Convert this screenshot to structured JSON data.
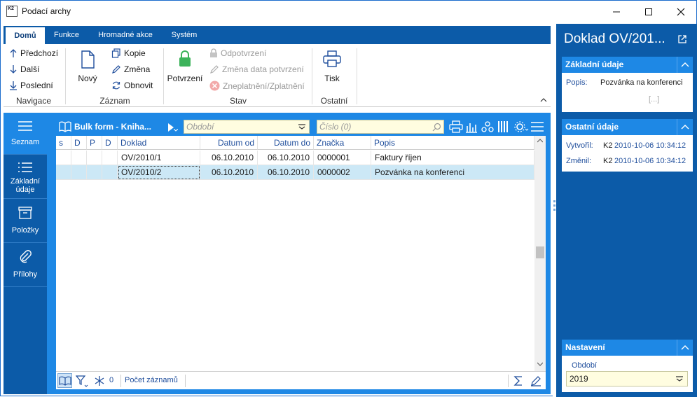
{
  "window": {
    "title": "Podací archy",
    "icon_text": "K2"
  },
  "ribbon": {
    "tabs": [
      "Domů",
      "Funkce",
      "Hromadné akce",
      "Systém"
    ],
    "navigace": {
      "label": "Navigace",
      "items": [
        "Předchozí",
        "Další",
        "Poslední"
      ]
    },
    "zaznam": {
      "label": "Záznam",
      "new": "Nový",
      "items": [
        "Kopie",
        "Změna",
        "Obnovit"
      ]
    },
    "stav": {
      "label": "Stav",
      "confirm": "Potvrzení",
      "items": [
        "Odpotvrzení",
        "Změna data potvrzení",
        "Zneplatnění/Zplatnění"
      ]
    },
    "ostatni": {
      "label": "Ostatní",
      "print": "Tisk"
    }
  },
  "leftnav": [
    {
      "label": "Seznam",
      "icon": "menu-icon"
    },
    {
      "label": "Základní\núdaje",
      "icon": "list-icon"
    },
    {
      "label": "Položky",
      "icon": "box-icon"
    },
    {
      "label": "Přílohy",
      "icon": "paperclip-icon"
    }
  ],
  "grid": {
    "bookmark": "Bulk form - Kniha...",
    "period_placeholder": "Období",
    "number_placeholder": "Číslo (0)",
    "columns": [
      "s",
      "D",
      "P",
      "D",
      "Doklad",
      "Datum od",
      "Datum do",
      "Značka",
      "Popis"
    ],
    "rows": [
      {
        "doklad": "OV/2010/1",
        "datum_od": "06.10.2010",
        "datum_do": "06.10.2010",
        "znacka": "0000001",
        "popis": "Faktury říjen"
      },
      {
        "doklad": "OV/2010/2",
        "datum_od": "06.10.2010",
        "datum_do": "06.10.2010",
        "znacka": "0000002",
        "popis": "Pozvánka na konferenci"
      }
    ],
    "status": {
      "count": "0",
      "records_label": "Počet záznamů"
    }
  },
  "right": {
    "title": "Doklad OV/201...",
    "zakladni": {
      "header": "Základní údaje",
      "popis_key": "Popis:",
      "popis_val": "Pozvánka na konferenci",
      "more": "[...]"
    },
    "ostatni": {
      "header": "Ostatní údaje",
      "created_key": "Vytvořil:",
      "created_user": "K2",
      "created_date": "2010-10-06 10:34:12",
      "changed_key": "Změnil:",
      "changed_user": "K2",
      "changed_date": "2010-10-06 10:34:12"
    },
    "nastaveni": {
      "header": "Nastavení",
      "period_label": "Období",
      "period_value": "2019"
    }
  },
  "colors": {
    "accent": "#0c5ba8",
    "accent_light": "#1e88e5",
    "selected_row": "#cce8f6",
    "input_bg": "#fffde0"
  }
}
